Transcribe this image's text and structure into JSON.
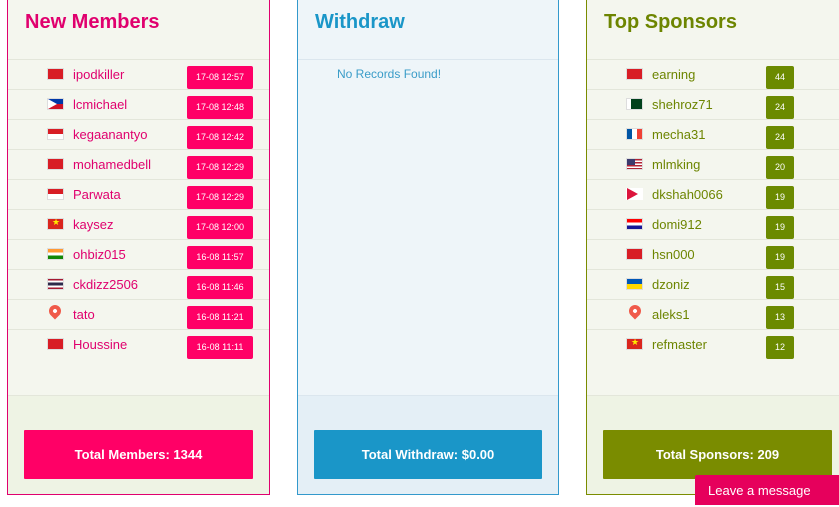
{
  "members": {
    "title": "New Members",
    "rows": [
      {
        "name": "ipodkiller",
        "time": "17-08 12:57",
        "flag": "red-flag-icon"
      },
      {
        "name": "lcmichael",
        "time": "17-08 12:48",
        "flag": "philippines-flag-icon"
      },
      {
        "name": "kegaanantyo",
        "time": "17-08 12:42",
        "flag": "indonesia-flag-icon"
      },
      {
        "name": "mohamedbell",
        "time": "17-08 12:29",
        "flag": "red-flag-icon"
      },
      {
        "name": "Parwata",
        "time": "17-08 12:29",
        "flag": "indonesia-flag-icon"
      },
      {
        "name": "kaysez",
        "time": "17-08 12:00",
        "flag": "vietnam-flag-icon"
      },
      {
        "name": "ohbiz015",
        "time": "16-08 11:57",
        "flag": "india-flag-icon"
      },
      {
        "name": "ckdizz2506",
        "time": "16-08 11:46",
        "flag": "thailand-flag-icon"
      },
      {
        "name": "tato",
        "time": "16-08 11:21",
        "flag": "location-pin-icon"
      },
      {
        "name": "Houssine",
        "time": "16-08 11:11",
        "flag": "red-flag-icon"
      }
    ],
    "total_label": "Total Members: 1344"
  },
  "withdraw": {
    "title": "Withdraw",
    "empty_text": "No Records Found!",
    "total_label": "Total Withdraw: $0.00"
  },
  "sponsors": {
    "title": "Top Sponsors",
    "rows": [
      {
        "name": "earning",
        "count": "44",
        "flag": "red-flag-icon"
      },
      {
        "name": "shehroz71",
        "count": "24",
        "flag": "pakistan-flag-icon"
      },
      {
        "name": "mecha31",
        "count": "24",
        "flag": "france-flag-icon"
      },
      {
        "name": "mlmking",
        "count": "20",
        "flag": "usa-flag-icon"
      },
      {
        "name": "dkshah0066",
        "count": "19",
        "flag": "nepal-flag-icon"
      },
      {
        "name": "domi912",
        "count": "19",
        "flag": "croatia-flag-icon"
      },
      {
        "name": "hsn000",
        "count": "19",
        "flag": "red-flag-icon"
      },
      {
        "name": "dzoniz",
        "count": "15",
        "flag": "ukraine-flag-icon"
      },
      {
        "name": "aleks1",
        "count": "13",
        "flag": "location-pin-icon"
      },
      {
        "name": "refmaster",
        "count": "12",
        "flag": "vietnam-flag-icon"
      }
    ],
    "total_label": "Total Sponsors: 209"
  },
  "chat": {
    "label": "Leave a message"
  },
  "colors": {
    "members_accent": "#e0006e",
    "withdraw_accent": "#1a96c8",
    "sponsors_accent": "#7a8c00"
  }
}
